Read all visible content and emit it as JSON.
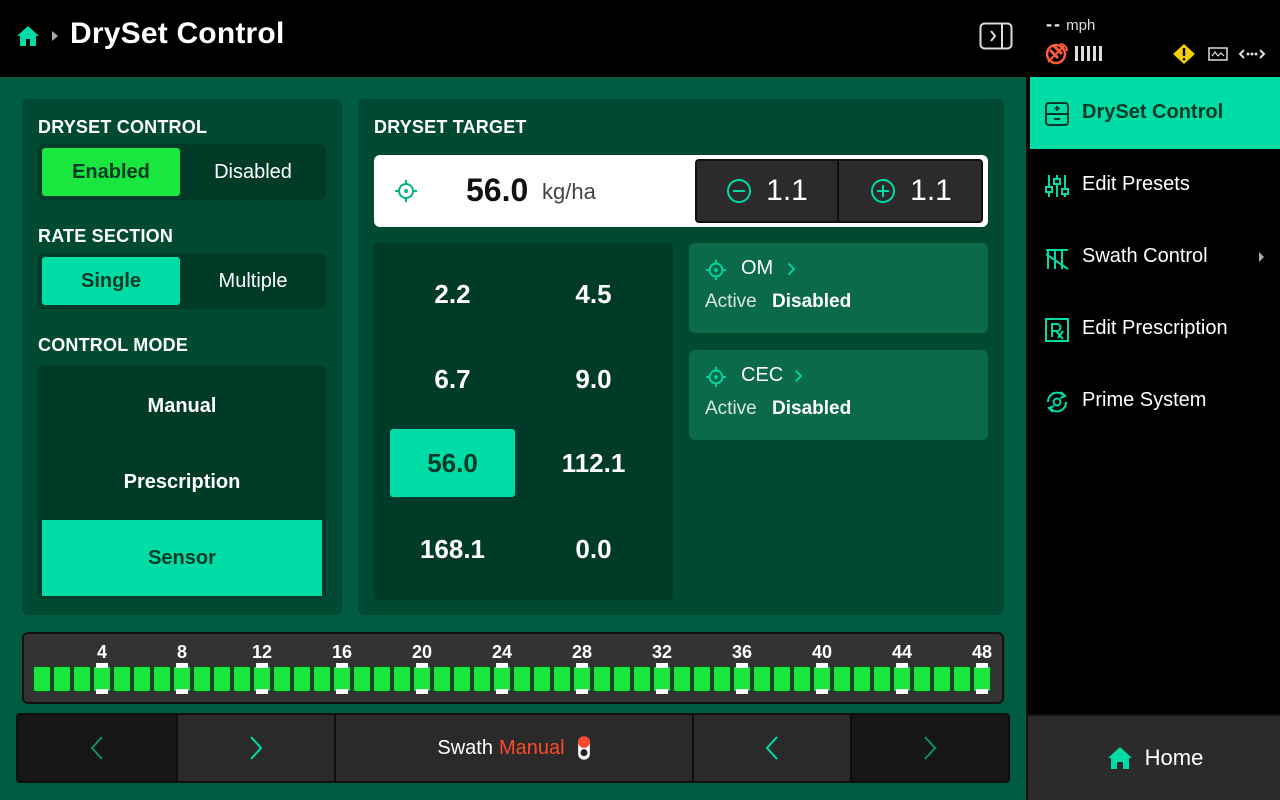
{
  "header": {
    "title": "DrySet Control",
    "speed_value": "--",
    "speed_unit": "mph"
  },
  "colors": {
    "accent_teal": "#00dca6",
    "enabled_green": "#19e63f",
    "main_bg": "#005c40",
    "panel_bg": "#004a33",
    "alert_red": "#ff4a2a",
    "warning_yellow": "#f5d000"
  },
  "icons": [
    "home-icon",
    "breadcrumb-arrow-icon",
    "panel-toggle-icon",
    "gps-icon",
    "signal-bars-icon",
    "warning-icon",
    "display-icon",
    "link-icon",
    "crosshair-icon",
    "minus-circle-icon",
    "plus-circle-icon",
    "chevron-right-icon",
    "chevron-left-icon"
  ],
  "dryset_control": {
    "label": "DRYSET CONTROL",
    "options": [
      "Enabled",
      "Disabled"
    ],
    "selected": "Enabled"
  },
  "rate_section": {
    "label": "RATE SECTION",
    "options": [
      "Single",
      "Multiple"
    ],
    "selected": "Single"
  },
  "control_mode": {
    "label": "CONTROL MODE",
    "options": [
      "Manual",
      "Prescription",
      "Sensor"
    ],
    "selected": "Sensor"
  },
  "dryset_target": {
    "label": "DRYSET TARGET",
    "value": "56.0",
    "unit": "kg/ha",
    "decrement": "1.1",
    "increment": "1.1"
  },
  "presets": [
    "2.2",
    "4.5",
    "6.7",
    "9.0",
    "56.0",
    "112.1",
    "168.1",
    "0.0"
  ],
  "selected_preset": "56.0",
  "sensors": [
    {
      "name": "OM",
      "status_label": "Active",
      "status_value": "Disabled"
    },
    {
      "name": "CEC",
      "status_label": "Active",
      "status_value": "Disabled"
    }
  ],
  "section_bar": {
    "labels": [
      "4",
      "8",
      "12",
      "16",
      "20",
      "24",
      "28",
      "32",
      "36",
      "40",
      "44",
      "48"
    ],
    "section_count": 48,
    "all_on": true
  },
  "bottom_bar": {
    "swath_label": "Swath",
    "swath_mode": "Manual"
  },
  "sidebar": {
    "items": [
      {
        "label": "DrySet Control",
        "icon": "dryset-icon",
        "active": true
      },
      {
        "label": "Edit Presets",
        "icon": "presets-icon",
        "active": false
      },
      {
        "label": "Swath Control",
        "icon": "swath-icon",
        "active": false,
        "has_submenu": true
      },
      {
        "label": "Edit Prescription",
        "icon": "prescription-icon",
        "active": false
      },
      {
        "label": "Prime System",
        "icon": "prime-icon",
        "active": false
      }
    ],
    "home_label": "Home"
  }
}
